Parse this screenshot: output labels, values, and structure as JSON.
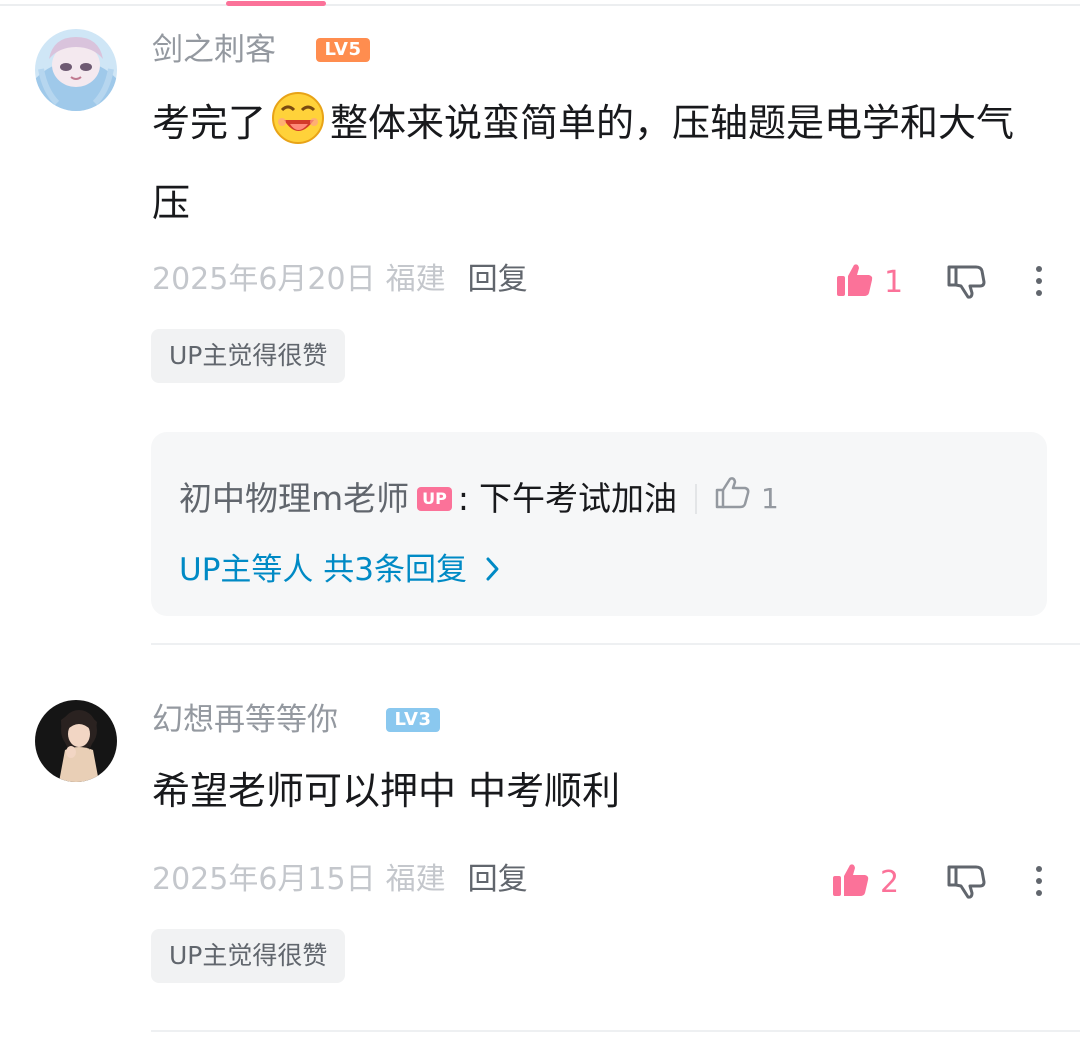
{
  "comments": [
    {
      "username": "剑之刺客",
      "level": "LV5",
      "text_before": "考完了",
      "emoji": "laughing-face-emoji",
      "text_after": "整体来说蛮简单的，压轴题是电学和大气压",
      "date": "2025年6月20日",
      "location": "福建",
      "reply_label": "回复",
      "likes": "1",
      "tag": "UP主觉得很赞",
      "reply_preview": {
        "name": "初中物理m老师",
        "badge": "UP",
        "colon": ":",
        "text": "下午考试加油",
        "likes": "1",
        "more_label": "UP主等人 共3条回复",
        "more_icon": "chevron-right-icon"
      }
    },
    {
      "username": "幻想再等等你",
      "level": "LV3",
      "text": "希望老师可以押中 中考顺利",
      "date": "2025年6月15日",
      "location": "福建",
      "reply_label": "回复",
      "likes": "2",
      "tag": "UP主觉得很赞"
    }
  ],
  "colors": {
    "accent_pink": "#fb7299",
    "link_blue": "#008ac5",
    "lv5": "#ff8d4f",
    "lv3": "#8ac8ef",
    "meta_gray": "#c4c7cc"
  }
}
